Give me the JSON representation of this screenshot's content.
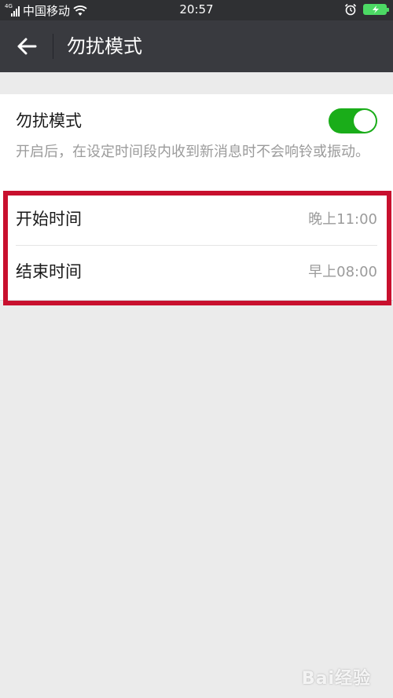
{
  "status_bar": {
    "network_tag": "4G",
    "carrier": "中国移动",
    "time": "20:57"
  },
  "app_bar": {
    "title": "勿扰模式"
  },
  "dnd": {
    "title": "勿扰模式",
    "enabled": true,
    "description": "开启后，在设定时间段内收到新消息时不会响铃或振动。"
  },
  "schedule": {
    "start": {
      "label": "开始时间",
      "value": "晚上11:00"
    },
    "end": {
      "label": "结束时间",
      "value": "早上08:00"
    }
  },
  "colors": {
    "accent_green": "#1aad19",
    "highlight_red": "#c8102e",
    "app_bar_bg": "#393a3f"
  },
  "watermark": "Bai经验"
}
